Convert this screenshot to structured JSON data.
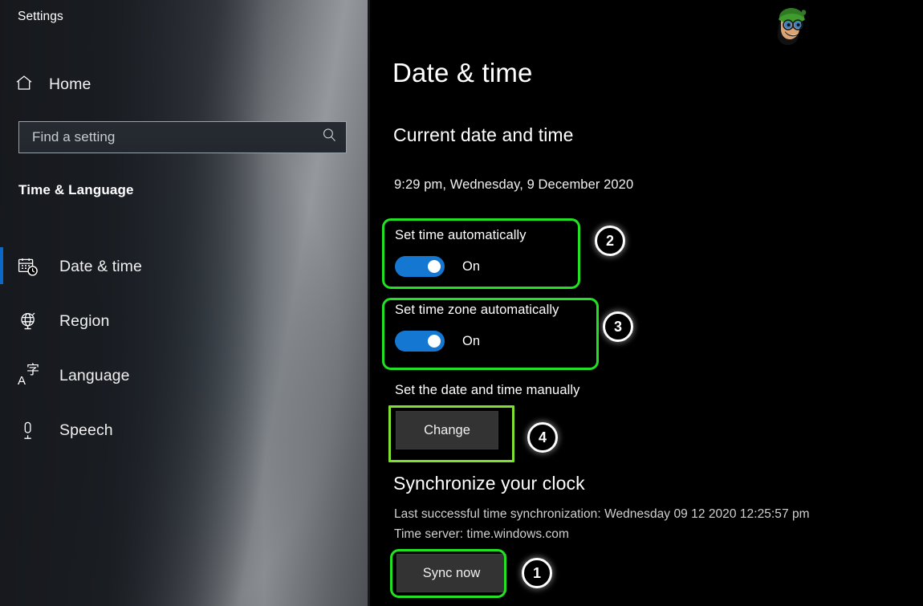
{
  "window": {
    "title": "Settings"
  },
  "sidebar": {
    "home": {
      "label": "Home",
      "icon": "home-icon"
    },
    "search": {
      "placeholder": "Find a setting",
      "value": "",
      "icon": "search-icon"
    },
    "category_title": "Time & Language",
    "items": [
      {
        "label": "Date & time",
        "icon": "calendar-clock-icon",
        "selected": true
      },
      {
        "label": "Region",
        "icon": "globe-icon",
        "selected": false
      },
      {
        "label": "Language",
        "icon": "language-icon",
        "selected": false
      },
      {
        "label": "Speech",
        "icon": "microphone-icon",
        "selected": false
      }
    ]
  },
  "main": {
    "page_title": "Date & time",
    "current_section": {
      "heading": "Current date and time",
      "datetime": "9:29 pm, Wednesday, 9 December 2020"
    },
    "set_time_automatically": {
      "label": "Set time automatically",
      "state": "On",
      "enabled": true
    },
    "set_timezone_automatically": {
      "label": "Set time zone automatically",
      "state": "On",
      "enabled": true
    },
    "manual": {
      "label": "Set the date and time manually",
      "change_button": "Change"
    },
    "sync_section": {
      "heading": "Synchronize your clock",
      "last_sync": "Last successful time synchronization: Wednesday 09 12 2020 12:25:57 pm",
      "time_server": "Time server: time.windows.com",
      "sync_button": "Sync now"
    }
  },
  "annotations": {
    "badges": [
      {
        "number": "1",
        "target": "sync-now-button"
      },
      {
        "number": "2",
        "target": "set-time-automatically"
      },
      {
        "number": "3",
        "target": "set-timezone-automatically"
      },
      {
        "number": "4",
        "target": "change-button"
      }
    ],
    "colors": {
      "highlight_green": "#22e022",
      "highlight_green_alt": "#7fe030",
      "badge_outline": "#ffffff"
    }
  },
  "colors": {
    "accent_blue": "#0a69c8",
    "toggle_on": "#1477d2",
    "content_background": "#000000",
    "button_face": "#333333"
  }
}
